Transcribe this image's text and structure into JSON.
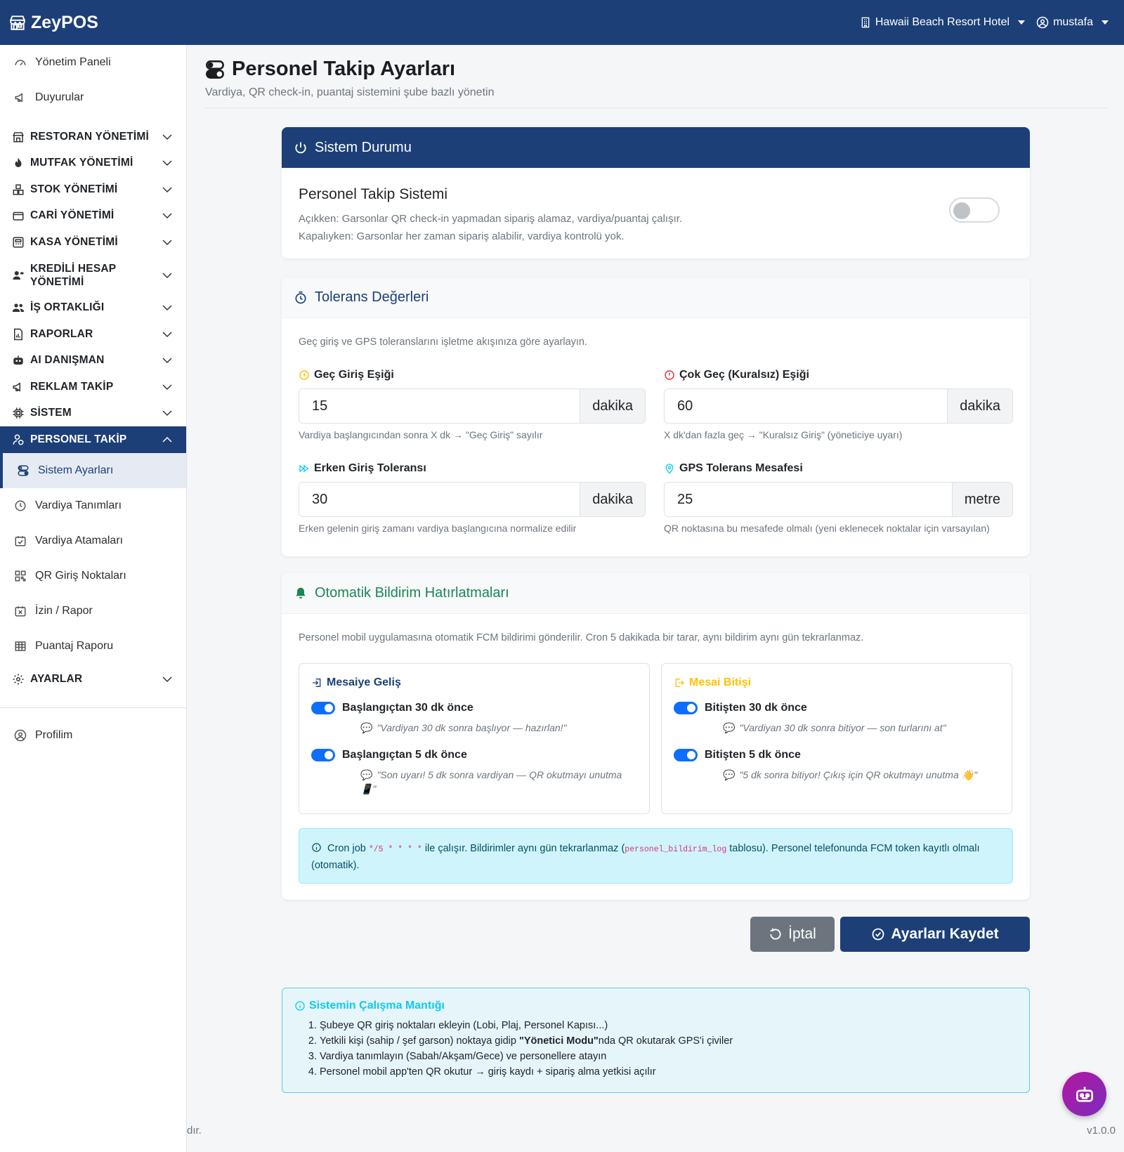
{
  "navbar": {
    "brand": "ZeyPOS",
    "branch": "Hawaii Beach Resort Hotel",
    "user": "mustafa"
  },
  "sidebar": {
    "top_links": [
      {
        "label": "Yönetim Paneli",
        "icon": "speedometer-icon"
      },
      {
        "label": "Duyurular",
        "icon": "megaphone-icon"
      }
    ],
    "sections": [
      {
        "label": "RESTORAN YÖNETİMİ",
        "icon": "shop-icon"
      },
      {
        "label": "MUTFAK YÖNETİMİ",
        "icon": "fire-icon"
      },
      {
        "label": "STOK YÖNETİMİ",
        "icon": "boxes-icon"
      },
      {
        "label": "CARİ YÖNETİMİ",
        "icon": "wallet-icon"
      },
      {
        "label": "KASA YÖNETİMİ",
        "icon": "cash-register-icon"
      },
      {
        "label": "KREDİLİ HESAP",
        "label2": "YÖNETİMİ",
        "icon": "person-credit-icon"
      },
      {
        "label": "İŞ ORTAKLIĞI",
        "icon": "people-icon"
      },
      {
        "label": "RAPORLAR",
        "icon": "report-icon"
      },
      {
        "label": "AI DANIŞMAN",
        "icon": "robot-icon"
      },
      {
        "label": "REKLAM TAKİP",
        "icon": "megaphone-icon"
      },
      {
        "label": "SİSTEM",
        "icon": "cpu-icon"
      }
    ],
    "active_section": {
      "label": "PERSONEL TAKİP",
      "icon": "person-badge-icon"
    },
    "sub_items": [
      {
        "label": "Sistem Ayarları",
        "icon": "toggles-icon"
      },
      {
        "label": "Vardiya Tanımları",
        "icon": "clock-icon"
      },
      {
        "label": "Vardiya Atamaları",
        "icon": "calendar-check-icon"
      },
      {
        "label": "QR Giriş Noktaları",
        "icon": "qr-code-icon"
      },
      {
        "label": "İzin / Rapor",
        "icon": "calendar-x-icon"
      },
      {
        "label": "Puantaj Raporu",
        "icon": "table-icon"
      }
    ],
    "settings_section": {
      "label": "AYARLAR",
      "icon": "gear-icon"
    },
    "profile": {
      "label": "Profilim",
      "icon": "person-circle-icon"
    }
  },
  "page": {
    "title": "Personel Takip Ayarları",
    "subtitle": "Vardiya, QR check-in, puantaj sistemini şube bazlı yönetin"
  },
  "system_status": {
    "header": "Sistem Durumu",
    "title": "Personel Takip Sistemi",
    "line1": "Açıkken: Garsonlar QR check-in yapmadan sipariş alamaz, vardiya/puantaj çalışır.",
    "line2": "Kapalıyken: Garsonlar her zaman sipariş alabilir, vardiya kontrolü yok.",
    "enabled": false
  },
  "tolerance": {
    "header": "Tolerans Değerleri",
    "intro": "Geç giriş ve GPS toleranslarını işletme akışınıza göre ayarlayın.",
    "late": {
      "label": "Geç Giriş Eşiği",
      "value": "15",
      "unit": "dakika",
      "help": "Vardiya başlangıcından sonra X dk → \"Geç Giriş\" sayılır"
    },
    "very_late": {
      "label": "Çok Geç (Kuralsız) Eşiği",
      "value": "60",
      "unit": "dakika",
      "help": "X dk'dan fazla geç → \"Kuralsız Giriş\" (yöneticiye uyarı)"
    },
    "early": {
      "label": "Erken Giriş Toleransı",
      "value": "30",
      "unit": "dakika",
      "help": "Erken gelenin giriş zamanı vardiya başlangıcına normalize edilir"
    },
    "gps": {
      "label": "GPS Tolerans Mesafesi",
      "value": "25",
      "unit": "metre",
      "help": "QR noktasına bu mesafede olmalı (yeni eklenecek noktalar için varsayılan)"
    }
  },
  "notifications": {
    "header": "Otomatik Bildirim Hatırlatmaları",
    "intro": "Personel mobil uygulamasına otomatik FCM bildirimi gönderilir. Cron 5 dakikada bir tarar, aynı bildirim aynı gün tekrarlanmaz.",
    "arrival": {
      "title": "Mesaiye Geliş",
      "items": [
        {
          "label": "Başlangıçtan 30 dk önce",
          "message": "\"Vardiyan 30 dk sonra başlıyor — hazırlan!\"",
          "enabled": true
        },
        {
          "label": "Başlangıçtan 5 dk önce",
          "message": "\"Son uyarı! 5 dk sonra vardiyan — QR okutmayı unutma 📱\"",
          "enabled": true
        }
      ]
    },
    "departure": {
      "title": "Mesai Bitişi",
      "items": [
        {
          "label": "Bitişten 30 dk önce",
          "message": "\"Vardiyan 30 dk sonra bitiyor — son turlarını at\"",
          "enabled": true
        },
        {
          "label": "Bitişten 5 dk önce",
          "message": "\"5 dk sonra bitiyor! Çıkış için QR okutmayı unutma 👋\"",
          "enabled": true
        }
      ]
    },
    "info": {
      "prefix": "Cron job",
      "cron": "*/5 * * * *",
      "middle": "ile çalışır. Bildirimler aynı gün tekrarlanmaz (",
      "table": "personel_bildirim_log",
      "suffix": "tablosu). Personel telefonunda FCM token kayıtlı olmalı (otomatik)."
    }
  },
  "actions": {
    "cancel": "İptal",
    "save": "Ayarları Kaydet"
  },
  "logic": {
    "title": "Sistemin Çalışma Mantığı",
    "step1": "Şubeye QR giriş noktaları ekleyin (Lobi, Plaj, Personel Kapısı...)",
    "step2_a": "Yetkili kişi (sahip / şef garson) noktaya gidip ",
    "step2_b": "\"Yönetici Modu\"",
    "step2_c": "nda QR okutarak GPS'i çiviler",
    "step3": "Vardiya tanımlayın (Sabah/Akşam/Gece) ve personellere atayın",
    "step4": "Personel mobil app'ten QR okutur → giriş kaydı + sipariş alma yetkisi açılır"
  },
  "footer": {
    "left": "dır.",
    "version": "v1.0.0"
  },
  "colors": {
    "primary": "#1c3f77",
    "success": "#198754",
    "toggle_on": "#0d6efd",
    "info_bg": "#cff4fc",
    "fab": "#b5179e"
  }
}
